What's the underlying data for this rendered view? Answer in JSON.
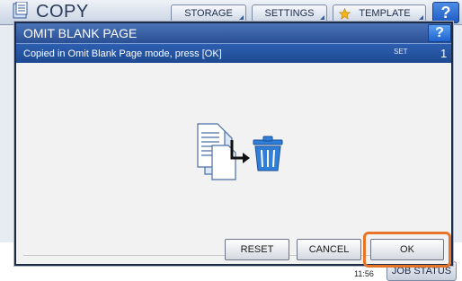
{
  "app": {
    "title": "COPY",
    "tabs": [
      {
        "label": "STORAGE"
      },
      {
        "label": "SETTINGS"
      },
      {
        "label": "TEMPLATE"
      }
    ],
    "help_label": "?",
    "time": "11:56",
    "job_status_label": "JOB STATUS"
  },
  "dialog": {
    "title": "OMIT BLANK PAGE",
    "help_label": "?",
    "message": "Copied in Omit Blank Page mode, press [OK]",
    "set_label": "SET",
    "set_value": "1",
    "buttons": {
      "reset": "RESET",
      "cancel": "CANCEL",
      "ok": "OK"
    }
  },
  "colors": {
    "header_blue": "#2a4f94",
    "message_blue": "#1e4a93",
    "highlight_orange": "#e8742a",
    "help_blue": "#1f63d0"
  },
  "icons": [
    "copy-icon",
    "star-icon",
    "document-to-trash-icon",
    "trash-icon"
  ]
}
